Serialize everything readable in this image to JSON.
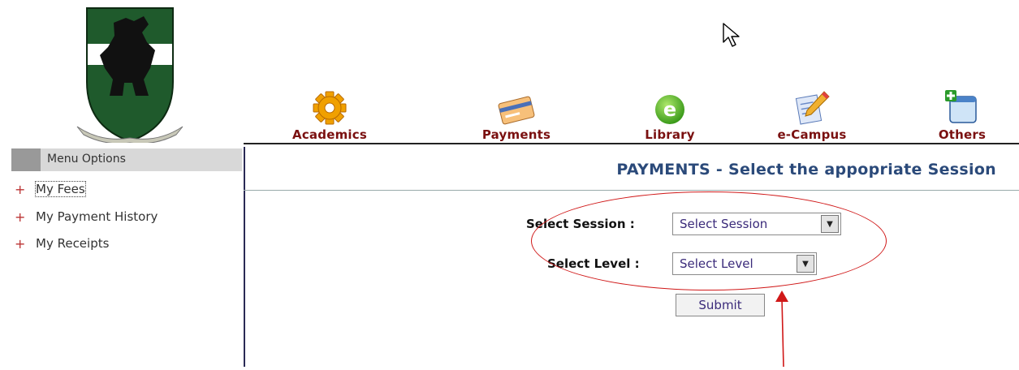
{
  "nav": {
    "items": [
      {
        "label": "Academics",
        "icon": "gear-icon"
      },
      {
        "label": "Payments",
        "icon": "credit-card-icon"
      },
      {
        "label": "Library",
        "icon": "e-globe-icon"
      },
      {
        "label": "e-Campus",
        "icon": "document-edit-icon"
      },
      {
        "label": "Others",
        "icon": "window-plus-icon"
      }
    ]
  },
  "sidebar": {
    "heading": "Menu Options",
    "items": [
      {
        "label": "My Fees"
      },
      {
        "label": "My Payment History"
      },
      {
        "label": "My Receipts"
      }
    ]
  },
  "main": {
    "title": "PAYMENTS - Select the appopriate Session",
    "session_label": "Select Session :",
    "session_value": "Select Session",
    "level_label": "Select Level :",
    "level_value": "Select Level",
    "submit_label": "Submit"
  },
  "colors": {
    "nav_label": "#7a1010",
    "title": "#2b4a7a",
    "annotation": "#d01818",
    "crest_green": "#1f5a2c"
  }
}
